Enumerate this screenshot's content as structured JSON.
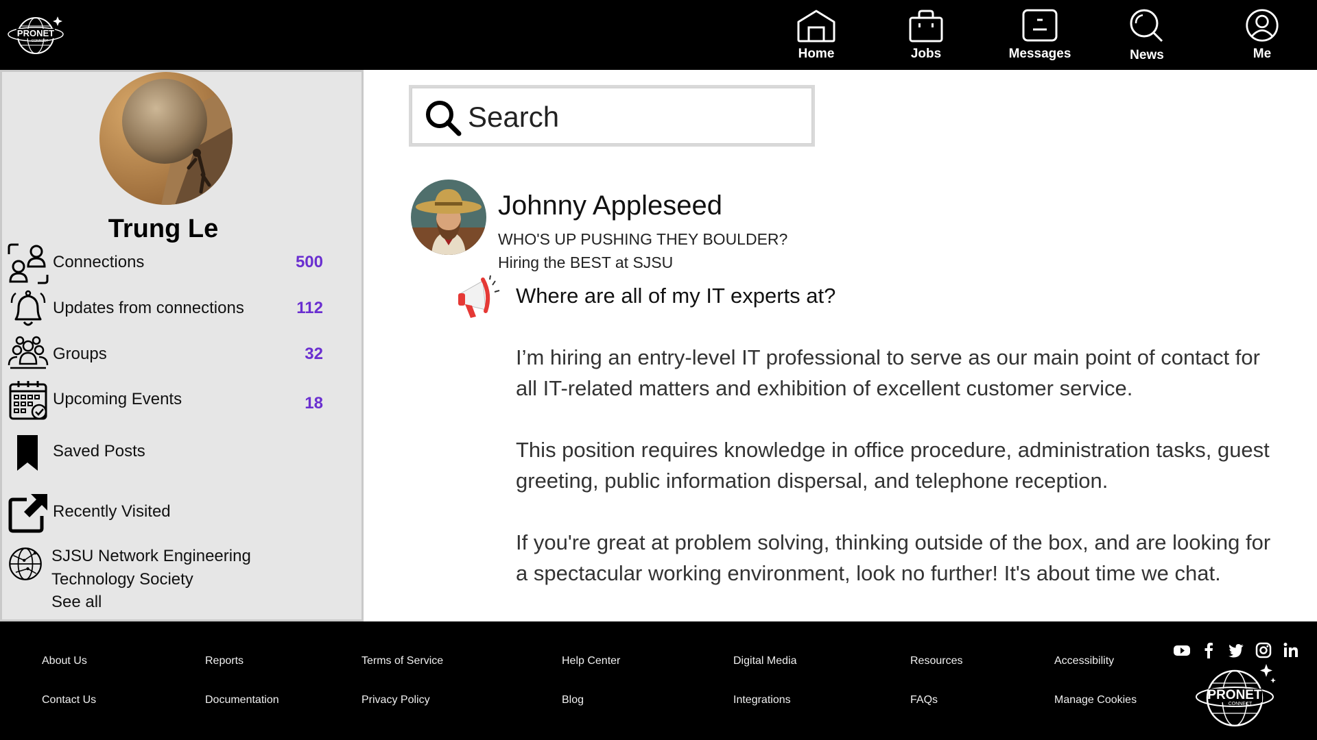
{
  "header": {
    "logo_text": "PRONET",
    "logo_sub": "CONNECT",
    "nav": [
      {
        "label": "Home",
        "icon": "home-icon"
      },
      {
        "label": "Jobs",
        "icon": "briefcase-icon"
      },
      {
        "label": "Messages",
        "icon": "message-icon"
      },
      {
        "label": "News",
        "icon": "search-news-icon"
      },
      {
        "label": "Me",
        "icon": "user-icon"
      }
    ]
  },
  "sidebar": {
    "name": "Trung Le",
    "items": [
      {
        "label": "Connections",
        "count": "500",
        "icon": "connections-icon"
      },
      {
        "label": "Updates from connections",
        "count": "112",
        "icon": "bell-icon"
      },
      {
        "label": "Groups",
        "count": "32",
        "icon": "groups-icon"
      },
      {
        "label": "Upcoming Events",
        "count": "18",
        "icon": "calendar-icon"
      },
      {
        "label": "Saved Posts",
        "icon": "bookmark-icon"
      },
      {
        "label": "Recently Visited",
        "icon": "external-link-icon"
      }
    ],
    "group": {
      "line1": "SJSU Network Engineering",
      "line2": "Technology Society",
      "icon": "globe-network-icon"
    },
    "see_all": "See all"
  },
  "search": {
    "placeholder": "Search"
  },
  "post": {
    "author": "Johnny Appleseed",
    "headline": "WHO'S UP PUSHING THEY BOULDER?",
    "sub": "Hiring the BEST at SJSU",
    "title": "Where are all of my IT experts at?",
    "paragraphs": [
      {
        "line1": "I’m hiring an entry-level IT professional to serve as our main point of contact for",
        "line2": "all IT-related matters and exhibition of excellent customer service."
      },
      {
        "line1": "This position requires knowledge in office procedure, administration tasks, guest",
        "line2": "greeting, public information dispersal, and telephone reception."
      },
      {
        "line1": "If you're great at problem solving, thinking outside of the box, and are looking for",
        "line2": "a spectacular working environment, look no further! It's about time we chat."
      }
    ]
  },
  "footer": {
    "links": [
      {
        "label": "About Us"
      },
      {
        "label": "Reports"
      },
      {
        "label": "Terms of Service"
      },
      {
        "label": "Help Center"
      },
      {
        "label": "Digital Media"
      },
      {
        "label": "Resources"
      },
      {
        "label": "Accessibility"
      },
      {
        "label": "Contact Us"
      },
      {
        "label": "Documentation"
      },
      {
        "label": "Privacy Policy"
      },
      {
        "label": "Blog"
      },
      {
        "label": "Integrations"
      },
      {
        "label": "FAQs"
      },
      {
        "label": "Manage Cookies"
      }
    ],
    "social": [
      "youtube-icon",
      "facebook-icon",
      "twitter-icon",
      "instagram-icon",
      "linkedin-icon"
    ]
  },
  "colors": {
    "count_accent": "#6a2fd0",
    "bar_bg": "#000000",
    "sidebar_bg": "#e6e6e6"
  }
}
